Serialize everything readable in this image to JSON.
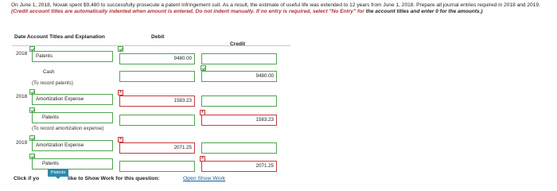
{
  "instructions": {
    "part1": "On June 1, 2018, Novak spent $9,480 to successfully prosecute a patent infringement suit. As a result, the estimate of useful life was extended to 12 years from June 1, 2018. Prepare all journal entries required in 2018 and 2019.",
    "part2": "(Credit account titles are automatically indented when amount is entered. Do not indent manually. If no entry is required, select \"No Entry\" for",
    "part3": "the account titles and enter 0 for the amounts.)"
  },
  "table_header": {
    "date_titles": "Date Account Titles and Explanation",
    "debit": "Debit",
    "credit": "Credit"
  },
  "rows": [
    {
      "year": "2018",
      "account": "Patents",
      "debit": "9480.00",
      "credit": ""
    },
    {
      "year": "",
      "account": "Cash",
      "debit": "",
      "credit": "9480.00"
    },
    {
      "memo": "(To record patents)"
    },
    {
      "year": "2018",
      "account": "Amortization Expense",
      "debit": "1583.23",
      "credit": ""
    },
    {
      "year": "",
      "account": "Patents",
      "debit": "",
      "credit": "1583.23"
    },
    {
      "memo": "(To record amortization expense)"
    },
    {
      "year": "2019",
      "account": "Amortization Expense",
      "debit": "2071.25",
      "credit": ""
    },
    {
      "year": "",
      "account": "Patents",
      "debit": "",
      "credit": "2071.25"
    }
  ],
  "footer": {
    "prefix": "Click if yo",
    "tooltip": "Patents",
    "suffix": "like to Show Work for this question:",
    "link": "Open Show Work"
  },
  "colors": {
    "correct": "#4fa54f",
    "incorrect": "#c63b3b",
    "link": "#1a5a9a"
  }
}
